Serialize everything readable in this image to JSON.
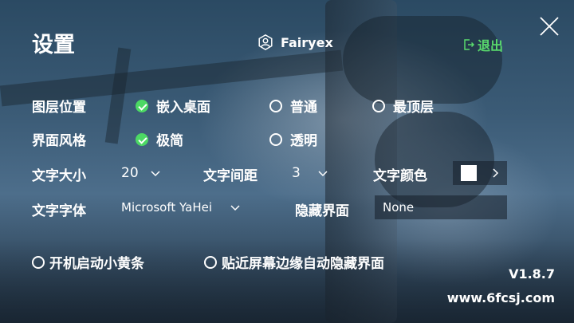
{
  "header": {
    "title": "设置",
    "username": "Fairyex",
    "logout_label": "退出"
  },
  "layer_position": {
    "label": "图层位置",
    "options": [
      {
        "label": "嵌入桌面",
        "selected": true
      },
      {
        "label": "普通",
        "selected": false
      },
      {
        "label": "最顶层",
        "selected": false
      }
    ]
  },
  "ui_style": {
    "label": "界面风格",
    "options": [
      {
        "label": "极简",
        "selected": true
      },
      {
        "label": "透明",
        "selected": false
      }
    ]
  },
  "text_size": {
    "label": "文字大小",
    "value": "20"
  },
  "text_spacing": {
    "label": "文字间距",
    "value": "3"
  },
  "text_color": {
    "label": "文字颜色",
    "value": "#ffffff"
  },
  "text_font": {
    "label": "文字字体",
    "value": "Microsoft YaHei"
  },
  "hide_ui": {
    "label": "隐藏界面",
    "value": "None"
  },
  "startup": {
    "label": "开机启动小黄条",
    "checked": false
  },
  "auto_hide": {
    "label": "贴近屏幕边缘自动隐藏界面",
    "checked": false
  },
  "footer": {
    "version": "V1.8.7",
    "site": "www.6fcsj.com"
  },
  "colors": {
    "accent_green": "#4cd964",
    "logout_green": "#59d96d"
  },
  "icons": {
    "user": "user-icon",
    "logout": "logout-icon",
    "close": "close-icon",
    "chevron": "chevron-down-icon"
  }
}
